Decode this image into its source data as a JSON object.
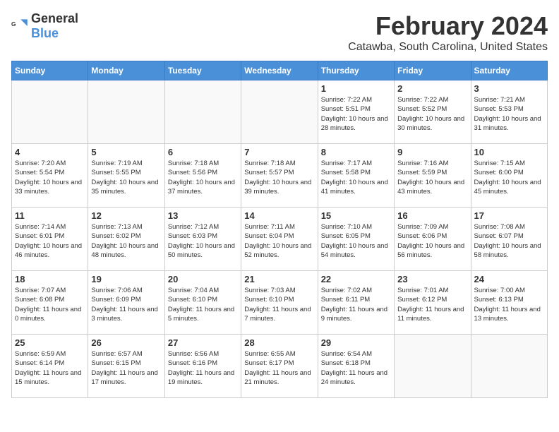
{
  "header": {
    "logo_general": "General",
    "logo_blue": "Blue",
    "month_year": "February 2024",
    "location": "Catawba, South Carolina, United States"
  },
  "calendar": {
    "days_of_week": [
      "Sunday",
      "Monday",
      "Tuesday",
      "Wednesday",
      "Thursday",
      "Friday",
      "Saturday"
    ],
    "weeks": [
      [
        {
          "day": "",
          "sunrise": "",
          "sunset": "",
          "daylight": "",
          "empty": true
        },
        {
          "day": "",
          "sunrise": "",
          "sunset": "",
          "daylight": "",
          "empty": true
        },
        {
          "day": "",
          "sunrise": "",
          "sunset": "",
          "daylight": "",
          "empty": true
        },
        {
          "day": "",
          "sunrise": "",
          "sunset": "",
          "daylight": "",
          "empty": true
        },
        {
          "day": "1",
          "sunrise": "Sunrise: 7:22 AM",
          "sunset": "Sunset: 5:51 PM",
          "daylight": "Daylight: 10 hours and 28 minutes.",
          "empty": false
        },
        {
          "day": "2",
          "sunrise": "Sunrise: 7:22 AM",
          "sunset": "Sunset: 5:52 PM",
          "daylight": "Daylight: 10 hours and 30 minutes.",
          "empty": false
        },
        {
          "day": "3",
          "sunrise": "Sunrise: 7:21 AM",
          "sunset": "Sunset: 5:53 PM",
          "daylight": "Daylight: 10 hours and 31 minutes.",
          "empty": false
        }
      ],
      [
        {
          "day": "4",
          "sunrise": "Sunrise: 7:20 AM",
          "sunset": "Sunset: 5:54 PM",
          "daylight": "Daylight: 10 hours and 33 minutes.",
          "empty": false
        },
        {
          "day": "5",
          "sunrise": "Sunrise: 7:19 AM",
          "sunset": "Sunset: 5:55 PM",
          "daylight": "Daylight: 10 hours and 35 minutes.",
          "empty": false
        },
        {
          "day": "6",
          "sunrise": "Sunrise: 7:18 AM",
          "sunset": "Sunset: 5:56 PM",
          "daylight": "Daylight: 10 hours and 37 minutes.",
          "empty": false
        },
        {
          "day": "7",
          "sunrise": "Sunrise: 7:18 AM",
          "sunset": "Sunset: 5:57 PM",
          "daylight": "Daylight: 10 hours and 39 minutes.",
          "empty": false
        },
        {
          "day": "8",
          "sunrise": "Sunrise: 7:17 AM",
          "sunset": "Sunset: 5:58 PM",
          "daylight": "Daylight: 10 hours and 41 minutes.",
          "empty": false
        },
        {
          "day": "9",
          "sunrise": "Sunrise: 7:16 AM",
          "sunset": "Sunset: 5:59 PM",
          "daylight": "Daylight: 10 hours and 43 minutes.",
          "empty": false
        },
        {
          "day": "10",
          "sunrise": "Sunrise: 7:15 AM",
          "sunset": "Sunset: 6:00 PM",
          "daylight": "Daylight: 10 hours and 45 minutes.",
          "empty": false
        }
      ],
      [
        {
          "day": "11",
          "sunrise": "Sunrise: 7:14 AM",
          "sunset": "Sunset: 6:01 PM",
          "daylight": "Daylight: 10 hours and 46 minutes.",
          "empty": false
        },
        {
          "day": "12",
          "sunrise": "Sunrise: 7:13 AM",
          "sunset": "Sunset: 6:02 PM",
          "daylight": "Daylight: 10 hours and 48 minutes.",
          "empty": false
        },
        {
          "day": "13",
          "sunrise": "Sunrise: 7:12 AM",
          "sunset": "Sunset: 6:03 PM",
          "daylight": "Daylight: 10 hours and 50 minutes.",
          "empty": false
        },
        {
          "day": "14",
          "sunrise": "Sunrise: 7:11 AM",
          "sunset": "Sunset: 6:04 PM",
          "daylight": "Daylight: 10 hours and 52 minutes.",
          "empty": false
        },
        {
          "day": "15",
          "sunrise": "Sunrise: 7:10 AM",
          "sunset": "Sunset: 6:05 PM",
          "daylight": "Daylight: 10 hours and 54 minutes.",
          "empty": false
        },
        {
          "day": "16",
          "sunrise": "Sunrise: 7:09 AM",
          "sunset": "Sunset: 6:06 PM",
          "daylight": "Daylight: 10 hours and 56 minutes.",
          "empty": false
        },
        {
          "day": "17",
          "sunrise": "Sunrise: 7:08 AM",
          "sunset": "Sunset: 6:07 PM",
          "daylight": "Daylight: 10 hours and 58 minutes.",
          "empty": false
        }
      ],
      [
        {
          "day": "18",
          "sunrise": "Sunrise: 7:07 AM",
          "sunset": "Sunset: 6:08 PM",
          "daylight": "Daylight: 11 hours and 0 minutes.",
          "empty": false
        },
        {
          "day": "19",
          "sunrise": "Sunrise: 7:06 AM",
          "sunset": "Sunset: 6:09 PM",
          "daylight": "Daylight: 11 hours and 3 minutes.",
          "empty": false
        },
        {
          "day": "20",
          "sunrise": "Sunrise: 7:04 AM",
          "sunset": "Sunset: 6:10 PM",
          "daylight": "Daylight: 11 hours and 5 minutes.",
          "empty": false
        },
        {
          "day": "21",
          "sunrise": "Sunrise: 7:03 AM",
          "sunset": "Sunset: 6:10 PM",
          "daylight": "Daylight: 11 hours and 7 minutes.",
          "empty": false
        },
        {
          "day": "22",
          "sunrise": "Sunrise: 7:02 AM",
          "sunset": "Sunset: 6:11 PM",
          "daylight": "Daylight: 11 hours and 9 minutes.",
          "empty": false
        },
        {
          "day": "23",
          "sunrise": "Sunrise: 7:01 AM",
          "sunset": "Sunset: 6:12 PM",
          "daylight": "Daylight: 11 hours and 11 minutes.",
          "empty": false
        },
        {
          "day": "24",
          "sunrise": "Sunrise: 7:00 AM",
          "sunset": "Sunset: 6:13 PM",
          "daylight": "Daylight: 11 hours and 13 minutes.",
          "empty": false
        }
      ],
      [
        {
          "day": "25",
          "sunrise": "Sunrise: 6:59 AM",
          "sunset": "Sunset: 6:14 PM",
          "daylight": "Daylight: 11 hours and 15 minutes.",
          "empty": false
        },
        {
          "day": "26",
          "sunrise": "Sunrise: 6:57 AM",
          "sunset": "Sunset: 6:15 PM",
          "daylight": "Daylight: 11 hours and 17 minutes.",
          "empty": false
        },
        {
          "day": "27",
          "sunrise": "Sunrise: 6:56 AM",
          "sunset": "Sunset: 6:16 PM",
          "daylight": "Daylight: 11 hours and 19 minutes.",
          "empty": false
        },
        {
          "day": "28",
          "sunrise": "Sunrise: 6:55 AM",
          "sunset": "Sunset: 6:17 PM",
          "daylight": "Daylight: 11 hours and 21 minutes.",
          "empty": false
        },
        {
          "day": "29",
          "sunrise": "Sunrise: 6:54 AM",
          "sunset": "Sunset: 6:18 PM",
          "daylight": "Daylight: 11 hours and 24 minutes.",
          "empty": false
        },
        {
          "day": "",
          "sunrise": "",
          "sunset": "",
          "daylight": "",
          "empty": true
        },
        {
          "day": "",
          "sunrise": "",
          "sunset": "",
          "daylight": "",
          "empty": true
        }
      ]
    ]
  }
}
